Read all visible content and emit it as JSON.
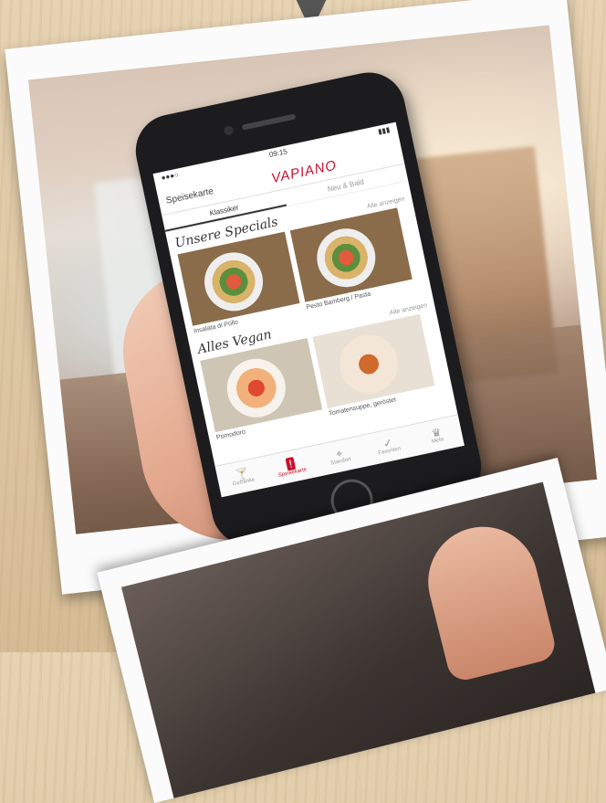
{
  "app": {
    "status_time": "09:15",
    "nav_back": "Speisekarte",
    "logo": "VAPIANO"
  },
  "tabs": [
    "Klassiker",
    "Neu & Bald"
  ],
  "sections": [
    {
      "title": "Unsere Specials",
      "more": "Alle anzeigen",
      "items": [
        {
          "caption": "Insalata di Pollo",
          "kind": "salad"
        },
        {
          "caption": "Pesto Bamberg / Pasta",
          "kind": "salad"
        }
      ]
    },
    {
      "title": "Alles Vegan",
      "more": "Alle anzeigen",
      "items": [
        {
          "caption": "Pomodoro",
          "kind": "pasta"
        },
        {
          "caption": "Tomatensuppe, geröstet",
          "kind": "soup"
        }
      ]
    }
  ],
  "tabbar": [
    {
      "label": "Getränke",
      "icon": "cocktail-icon"
    },
    {
      "label": "Speisekarte",
      "icon": "menu-icon",
      "active": true
    },
    {
      "label": "Standort",
      "icon": "location-icon"
    },
    {
      "label": "Favoriten",
      "icon": "check-icon"
    },
    {
      "label": "Mehr",
      "icon": "crown-icon"
    }
  ],
  "colors": {
    "brand": "#c8102e"
  }
}
